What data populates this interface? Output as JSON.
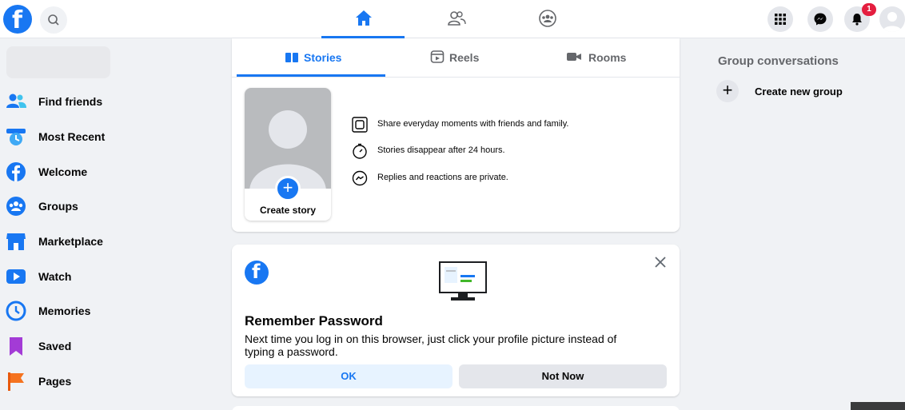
{
  "topbar": {
    "logo_letter": "f",
    "notification_count": "1"
  },
  "sidebar": {
    "items": [
      {
        "label": "Find friends",
        "icon": "friends-icon"
      },
      {
        "label": "Most Recent",
        "icon": "most-recent-icon"
      },
      {
        "label": "Welcome",
        "icon": "facebook-icon"
      },
      {
        "label": "Groups",
        "icon": "groups-icon"
      },
      {
        "label": "Marketplace",
        "icon": "marketplace-icon"
      },
      {
        "label": "Watch",
        "icon": "watch-icon"
      },
      {
        "label": "Memories",
        "icon": "memories-icon"
      },
      {
        "label": "Saved",
        "icon": "saved-icon"
      },
      {
        "label": "Pages",
        "icon": "pages-icon"
      }
    ]
  },
  "stories": {
    "tabs": [
      {
        "label": "Stories"
      },
      {
        "label": "Reels"
      },
      {
        "label": "Rooms"
      }
    ],
    "create_label": "Create story",
    "info": [
      "Share everyday moments with friends and family.",
      "Stories disappear after 24 hours.",
      "Replies and reactions are private."
    ]
  },
  "password_prompt": {
    "logo_letter": "f",
    "title": "Remember Password",
    "description": "Next time you log in on this browser, just click your profile picture instead of typing a password.",
    "ok_label": "OK",
    "not_now_label": "Not Now"
  },
  "right": {
    "title": "Group conversations",
    "create_label": "Create new group"
  },
  "colors": {
    "brand": "#1877f2",
    "background": "#f0f2f5",
    "notification": "#e41e3f"
  }
}
